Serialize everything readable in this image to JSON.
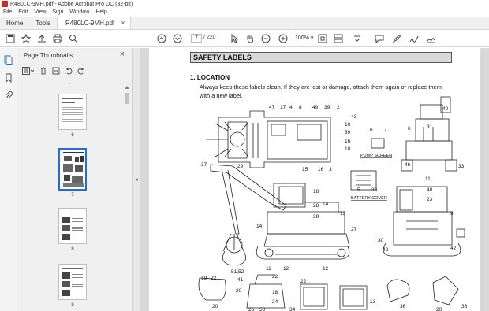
{
  "window": {
    "title": "R480LC-9MH.pdf - Adobe Acrobat Pro DC (32-bit)"
  },
  "menu": [
    "File",
    "Edit",
    "View",
    "Sign",
    "Window",
    "Help"
  ],
  "tabs": {
    "home": "Home",
    "tools": "Tools",
    "document": "R480LC-9MH.pdf"
  },
  "toolbar": {
    "page_current": "7",
    "page_total": "/ 220",
    "zoom": "100%"
  },
  "thumbnails": {
    "title": "Page Thumbnails",
    "pages": [
      "6",
      "7",
      "8",
      "9"
    ],
    "selected": "7"
  },
  "page": {
    "section_title": "SAFETY LABELS",
    "heading": "1. LOCATION",
    "body": "Always keep these labels clean.  If they are lost or damage, attach them again or replace them with a new label.",
    "captions": {
      "pump_screen": "PUMP SCREEN",
      "battery_cover": "BATTERY COVER"
    },
    "callouts": [
      "47",
      "17",
      "4",
      "8",
      "49",
      "39",
      "2",
      "43",
      "10",
      "39",
      "16",
      "10",
      "15",
      "16",
      "3",
      "6",
      "7",
      "6",
      "31",
      "40",
      "46",
      "11",
      "33",
      "37",
      "29",
      "18",
      "28",
      "39",
      "14",
      "13",
      "27",
      "14",
      "12",
      "11",
      "12",
      "5",
      "38",
      "48",
      "23",
      "9",
      "30",
      "42",
      "42",
      "19",
      "22",
      "51,52",
      "41",
      "22",
      "20",
      "18",
      "24",
      "25",
      "50",
      "22",
      "13",
      "36",
      "34",
      "20",
      "36"
    ]
  },
  "colors": {
    "accent": "#1e6fd9",
    "app_red": "#d4261c"
  }
}
